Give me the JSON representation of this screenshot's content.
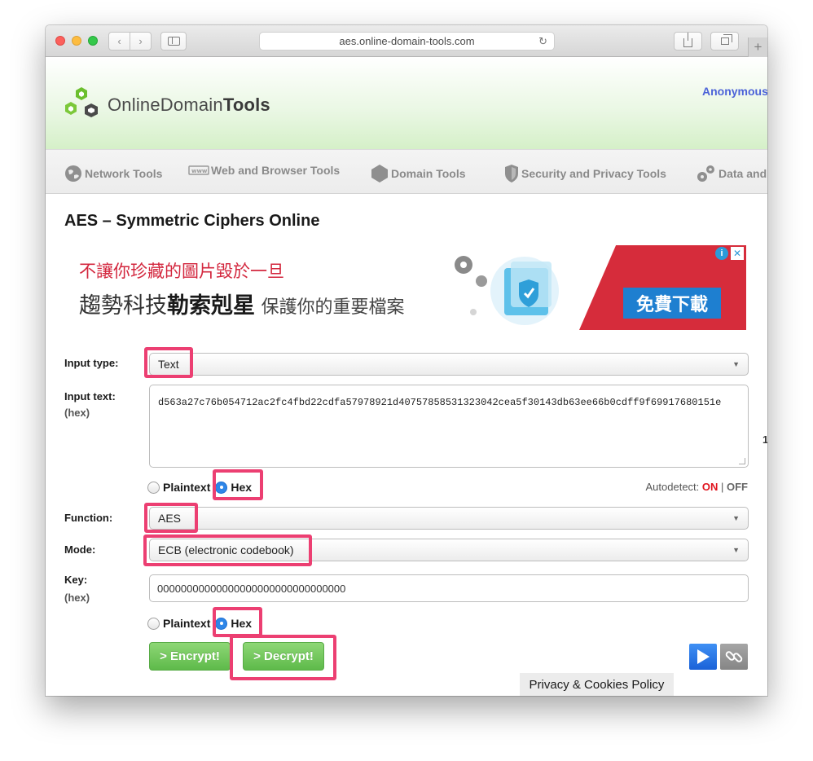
{
  "browser": {
    "url": "aes.online-domain-tools.com",
    "new_tab": "+"
  },
  "site": {
    "logo_text_prefix": "Online",
    "logo_text_mid": "Domain",
    "logo_text_bold": "Tools",
    "user": "Anonymous",
    "nav": [
      {
        "label": "Network Tools",
        "icon": "globe-icon"
      },
      {
        "label": "Web and Browser Tools",
        "icon": "www-icon"
      },
      {
        "label": "Domain Tools",
        "icon": "hexagon-icon"
      },
      {
        "label": "Security and Privacy Tools",
        "icon": "shield-icon"
      },
      {
        "label": "Data and",
        "icon": "gears-icon"
      }
    ]
  },
  "page": {
    "title": "AES – Symmetric Ciphers Online"
  },
  "ad": {
    "line1": "不讓你珍藏的圖片毀於一旦",
    "line2_a": "趨勢科技",
    "line2_b": "勒索剋星",
    "line2_c": "保護你的重要檔案",
    "cta": "免費下載",
    "info": "i",
    "close": "✕"
  },
  "form": {
    "input_type_label": "Input type:",
    "input_type_value": "Text",
    "input_text_label": "Input text:",
    "input_text_sub": "(hex)",
    "input_text_value": "d563a27c76b054712ac2fc4fbd22cdfa57978921d40757858531323042cea5f30143db63ee66b0cdff9f69917680151e",
    "side_fragment": "1",
    "format1_plaintext": "Plaintext",
    "format1_hex": "Hex",
    "autodetect_label": "Autodetect: ",
    "autodetect_on": "ON",
    "autodetect_sep": " | ",
    "autodetect_off": "OFF",
    "function_label": "Function:",
    "function_value": "AES",
    "mode_label": "Mode:",
    "mode_value": "ECB (electronic codebook)",
    "key_label": "Key:",
    "key_sub": "(hex)",
    "key_value": "00000000000000000000000000000000",
    "format2_plaintext": "Plaintext",
    "format2_hex": "Hex",
    "encrypt_label": "> Encrypt!",
    "decrypt_label": "> Decrypt!",
    "caret": "▼"
  },
  "footer": {
    "privacy": "Privacy & Cookies Policy"
  },
  "colors": {
    "highlight": "#ec3f72",
    "button_green": "#6cc457",
    "autodetect_on": "#e0141e",
    "link_blue": "#4b62d8"
  }
}
